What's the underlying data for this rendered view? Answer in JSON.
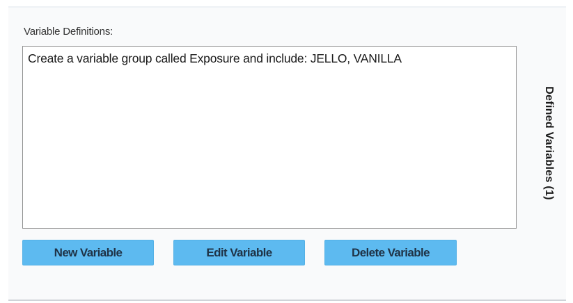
{
  "variable_definitions": {
    "label": "Variable Definitions:",
    "entries": [
      "Create a variable group called Exposure and include: JELLO, VANILLA"
    ]
  },
  "buttons": {
    "new_variable": "New Variable",
    "edit_variable": "Edit Variable",
    "delete_variable": "Delete Variable"
  },
  "side_tab": {
    "label": "Defined Variables (1)"
  },
  "colors": {
    "button_fill": "#5dbaf0",
    "button_text": "#1f3347",
    "panel_background": "#f9fafb"
  }
}
